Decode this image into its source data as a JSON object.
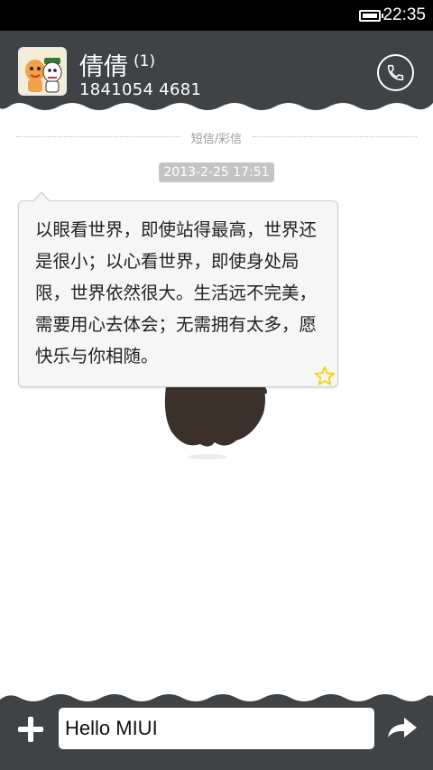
{
  "status_bar": {
    "time": "22:35",
    "battery_icon": "battery-full-icon"
  },
  "header": {
    "contact_name": "倩倩",
    "unread_count": "(1)",
    "phone_number": "1841054 4681",
    "call_icon": "phone-icon",
    "avatar_icon": "contact-avatar"
  },
  "conversation": {
    "section_label": "短信/彩信",
    "timestamp": "2013-2-25 17:51",
    "messages": [
      {
        "text": "以眼看世界，即使站得最高，世界还是很小；以心看世界，即使身处局限，世界依然很大。生活远不完美，需要用心去体会；无需拥有太多，愿快乐与你相随。",
        "star_icon": "star-outline-icon"
      }
    ]
  },
  "composer": {
    "attach_icon": "plus-icon",
    "input_value": "Hello MIUI",
    "send_icon": "send-arrow-icon"
  },
  "colors": {
    "header_bg": "#3f4345",
    "bottom_bg": "#3f4345",
    "status_bg": "#000000",
    "bubble_bg": "#f6f6f6",
    "star": "#f2d400",
    "timestamp_bg": "#c4c4c4"
  }
}
